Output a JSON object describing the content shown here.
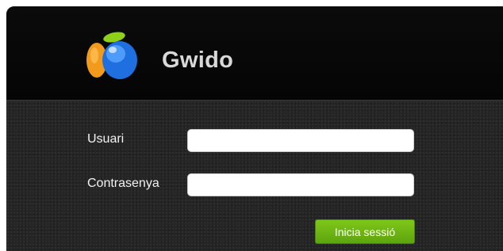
{
  "header": {
    "app_name": "Gwido",
    "logo_icon": "gwido-logo-icon"
  },
  "login_form": {
    "username_label": "Usuari",
    "username_value": "",
    "password_label": "Contrasenya",
    "password_value": "",
    "submit_label": "Inicia sessió"
  },
  "colors": {
    "header_background": "#050505",
    "form_background": "#252525",
    "button_green": "#6cb514",
    "label_text": "#f2f2f2",
    "title_text": "#d9d9d9"
  }
}
